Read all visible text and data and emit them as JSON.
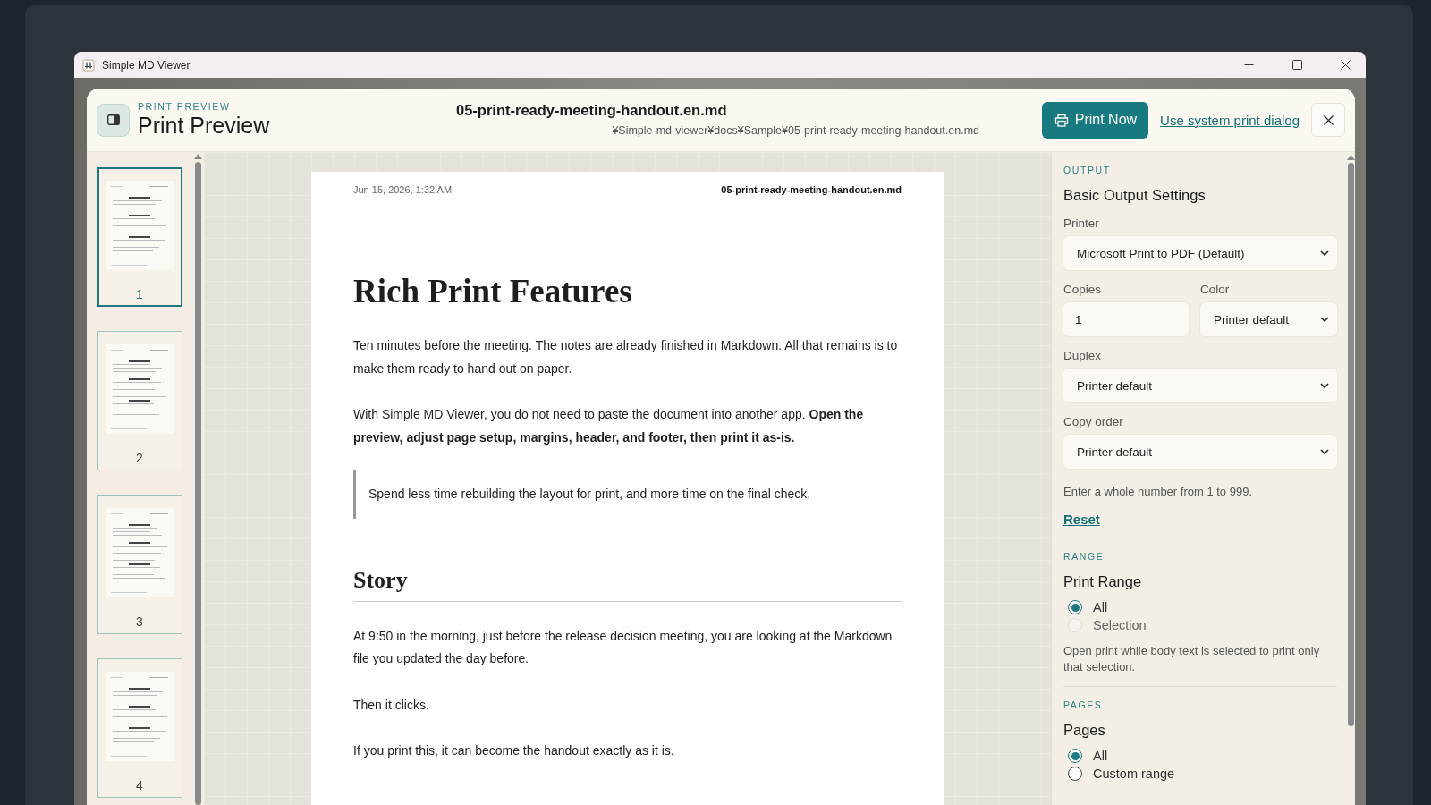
{
  "window": {
    "title": "Simple MD Viewer"
  },
  "header": {
    "eyebrow": "PRINT PREVIEW",
    "title": "Print Preview",
    "file_name": "05-print-ready-meeting-handout.en.md",
    "file_path": "¥Simple-md-viewer¥docs¥Sample¥05-print-ready-meeting-handout.en.md",
    "print_button": "Print Now",
    "system_dialog_link": "Use system print dialog"
  },
  "thumbnails": [
    {
      "label": "1",
      "selected": true
    },
    {
      "label": "2",
      "selected": false
    },
    {
      "label": "3",
      "selected": false
    },
    {
      "label": "4",
      "selected": false
    }
  ],
  "page": {
    "header_date": "Jun 15, 2026, 1:32 AM",
    "header_file": "05-print-ready-meeting-handout.en.md",
    "blocks": [
      {
        "kind": "h1",
        "text": "Rich Print Features"
      },
      {
        "kind": "p",
        "text": "Ten minutes before the meeting. The notes are already finished in Markdown. All that remains is to make them ready to hand out on paper."
      },
      {
        "kind": "p",
        "text": "With Simple MD Viewer, you do not need to paste the document into another app. **Open the preview, adjust page setup, margins, header, and footer, then print it as-is.**"
      },
      {
        "kind": "quote",
        "text": "Spend less time rebuilding the layout for print, and more time on the final check."
      },
      {
        "kind": "h2",
        "text": "Story"
      },
      {
        "kind": "p",
        "text": "At 9:50 in the morning, just before the release decision meeting, you are looking at the Markdown file you updated the day before."
      },
      {
        "kind": "p",
        "text": "Then it clicks."
      },
      {
        "kind": "p",
        "text": "If you print this, it can become the handout exactly as it is."
      }
    ]
  },
  "settings": {
    "output": {
      "eyebrow": "OUTPUT",
      "title": "Basic Output Settings",
      "printer": {
        "label": "Printer",
        "value": "Microsoft Print to PDF (Default)"
      },
      "copies": {
        "label": "Copies",
        "value": "1"
      },
      "color": {
        "label": "Color",
        "value": "Printer default"
      },
      "duplex": {
        "label": "Duplex",
        "value": "Printer default"
      },
      "copy_order": {
        "label": "Copy order",
        "value": "Printer default"
      },
      "hint": "Enter a whole number from 1 to 999.",
      "reset": "Reset"
    },
    "range": {
      "eyebrow": "RANGE",
      "title": "Print Range",
      "options": [
        {
          "label": "All",
          "selected": true,
          "disabled": false
        },
        {
          "label": "Selection",
          "selected": false,
          "disabled": true
        }
      ],
      "hint": "Open print while body text is selected to print only that selection."
    },
    "pages": {
      "eyebrow": "PAGES",
      "title": "Pages",
      "options": [
        {
          "label": "All",
          "selected": true,
          "disabled": false
        },
        {
          "label": "Custom range",
          "selected": false,
          "disabled": false
        }
      ]
    }
  }
}
